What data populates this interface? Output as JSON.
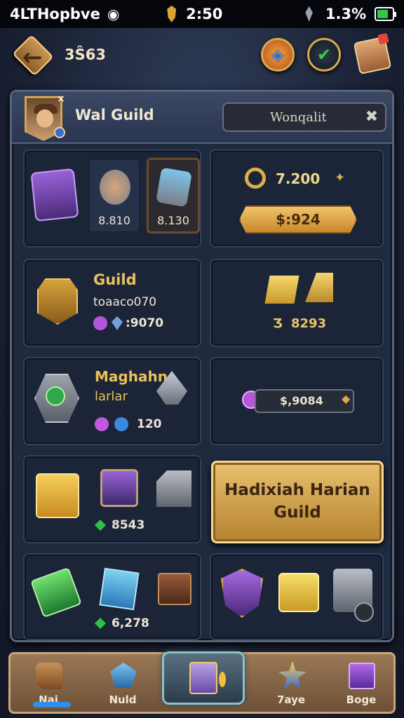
{
  "status_bar": {
    "carrier": "4LTHopbve",
    "time": "2:50",
    "battery_percent": "1.3%",
    "battery_level": 0.75
  },
  "top_bar": {
    "count": "3Ŝ63",
    "icons": [
      "back-arrow-icon",
      "compass-icon",
      "check-badge-icon",
      "gift-box-icon"
    ]
  },
  "header": {
    "guild_name": "Wal Guild",
    "search_value": "Wonqalit"
  },
  "resources": {
    "slot_left_value": "8.810",
    "slot_right_value": "8.130",
    "key_amount": "7.200",
    "price": "$:924"
  },
  "guild_card": {
    "title": "Guild",
    "subtitle": "toaaco070",
    "stat": ":9070",
    "gold_amount": "8293",
    "gold_prefix": "Ʒ"
  },
  "machine_card": {
    "title": "Maghahn",
    "subtitle": "larlar",
    "stat": "120",
    "slider_value": "$,9084"
  },
  "chest_card": {
    "stat": "8543"
  },
  "daily_button": {
    "line1": "Hadixiah Harian",
    "line2": "Guild"
  },
  "gems_card": {
    "stat": "6,278"
  },
  "bottom_nav": {
    "items": [
      {
        "label": "Nai",
        "icon": "hand-icon"
      },
      {
        "label": "Nuld",
        "icon": "crystal-icon"
      },
      {
        "label": "",
        "icon": "treasure-box-icon"
      },
      {
        "label": "7aye",
        "icon": "star-shard-icon"
      },
      {
        "label": "Boge",
        "icon": "purple-box-icon"
      }
    ]
  },
  "colors": {
    "accent_gold": "#e8c06e",
    "panel_bg": "#1f2a3f",
    "active_tab": "#2f8fe6"
  }
}
